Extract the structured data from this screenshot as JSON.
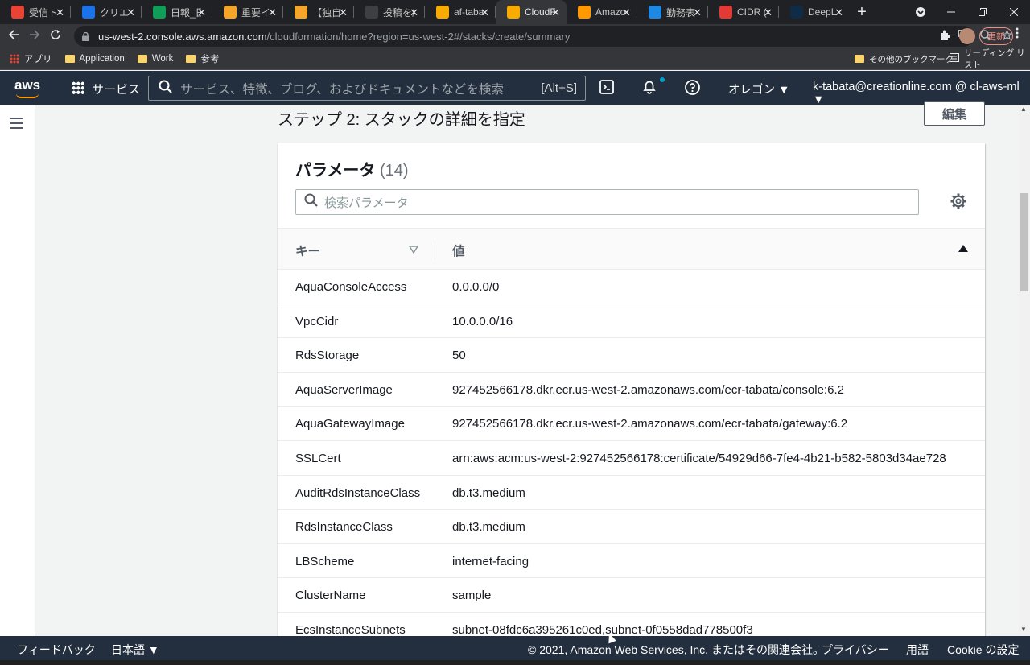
{
  "browser": {
    "tabs": [
      {
        "title": "受信トレ",
        "color": "#ea4335",
        "active": false
      },
      {
        "title": "クリエーション",
        "color": "#1a73e8",
        "active": false
      },
      {
        "title": "日報_日",
        "color": "#0f9d58",
        "active": false
      },
      {
        "title": "重要インフォ",
        "color": "#f4a62a",
        "active": false
      },
      {
        "title": "【独自ア",
        "color": "#f4a62a",
        "active": false
      },
      {
        "title": "投稿を編",
        "color": "#3c4043",
        "active": false
      },
      {
        "title": "af-taba",
        "color": "#f9ab00",
        "active": false
      },
      {
        "title": "CloudF",
        "color": "#f9ab00",
        "active": true
      },
      {
        "title": "Amazon",
        "color": "#ff9900",
        "active": false
      },
      {
        "title": "勤務表",
        "color": "#1e88e5",
        "active": false
      },
      {
        "title": "CIDR (",
        "color": "#e53935",
        "active": false
      },
      {
        "title": "DeepL",
        "color": "#0f2b46",
        "active": false
      }
    ],
    "new_tab_label": "+",
    "url_host": "us-west-2.console.aws.amazon.com",
    "url_path": "/cloudformation/home?region=us-west-2#/stacks/create/summary",
    "update_label": "更新",
    "bookmarks": [
      {
        "label": "アプリ",
        "type": "apps"
      },
      {
        "label": "Application",
        "type": "folder"
      },
      {
        "label": "Work",
        "type": "folder"
      },
      {
        "label": "参考",
        "type": "folder"
      }
    ],
    "other_bookmarks": "その他のブックマーク",
    "reading_list": "リーディング リスト"
  },
  "aws_header": {
    "logo": "aws",
    "services_label": "サービス",
    "search_placeholder": "サービス、特徴、ブログ、およびドキュメントなどを検索",
    "search_shortcut": "[Alt+S]",
    "region": "オレゴン ▼",
    "account": "k-tabata@creationline.com @ cl-aws-ml ▼"
  },
  "main": {
    "step_title": "ステップ 2: スタックの詳細を指定",
    "edit_label": "編集",
    "panel_title": "パラメータ",
    "panel_count": "(14)",
    "search_placeholder": "検索パラメータ",
    "col_key": "キー",
    "col_value": "値",
    "rows": [
      {
        "key": "AquaConsoleAccess",
        "value": "0.0.0.0/0"
      },
      {
        "key": "VpcCidr",
        "value": "10.0.0.0/16"
      },
      {
        "key": "RdsStorage",
        "value": "50"
      },
      {
        "key": "AquaServerImage",
        "value": "927452566178.dkr.ecr.us-west-2.amazonaws.com/ecr-tabata/console:6.2"
      },
      {
        "key": "AquaGatewayImage",
        "value": "927452566178.dkr.ecr.us-west-2.amazonaws.com/ecr-tabata/gateway:6.2"
      },
      {
        "key": "SSLCert",
        "value": "arn:aws:acm:us-west-2:927452566178:certificate/54929d66-7fe4-4b21-b582-5803d34ae728"
      },
      {
        "key": "AuditRdsInstanceClass",
        "value": "db.t3.medium"
      },
      {
        "key": "RdsInstanceClass",
        "value": "db.t3.medium"
      },
      {
        "key": "LBScheme",
        "value": "internet-facing"
      },
      {
        "key": "ClusterName",
        "value": "sample"
      },
      {
        "key": "EcsInstanceSubnets",
        "value": "subnet-08fdc6a395261c0ed,subnet-0f0558dad778500f3"
      }
    ]
  },
  "footer": {
    "feedback": "フィードバック",
    "language": "日本語 ▼",
    "copyright": "© 2021, Amazon Web Services, Inc. またはその関連会社。",
    "privacy": "プライバシー",
    "terms": "用語",
    "cookies": "Cookie の設定"
  }
}
